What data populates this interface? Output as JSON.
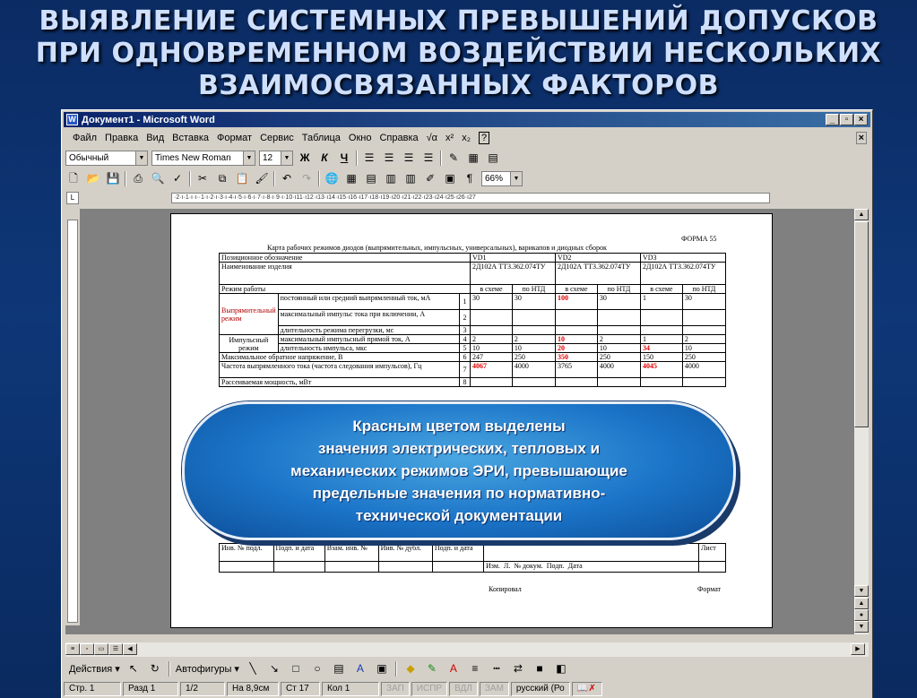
{
  "slide": {
    "title_line1": "ВЫЯВЛЕНИЕ СИСТЕМНЫХ ПРЕВЫШЕНИЙ ДОПУСКОВ",
    "title_line2": "ПРИ ОДНОВРЕМЕННОМ ВОЗДЕЙСТВИИ НЕСКОЛЬКИХ",
    "title_line3": "ВЗАИМОСВЯЗАННЫХ ФАКТОРОВ",
    "callout_line1": "Красным цветом выделены",
    "callout_line2": "значения электрических, тепловых и",
    "callout_line3": "механических режимов ЭРИ, превышающие",
    "callout_line4": "предельные значения по нормативно-",
    "callout_line5": "технической документации"
  },
  "window": {
    "title": "Документ1 - Microsoft Word",
    "minimize": "_",
    "maximize": "▫",
    "close": "×"
  },
  "menu": [
    "Файл",
    "Правка",
    "Вид",
    "Вставка",
    "Формат",
    "Сервис",
    "Таблица",
    "Окно",
    "Справка"
  ],
  "formatting": {
    "style": "Обычный",
    "font": "Times New Roman",
    "size": "12",
    "bold": "Ж",
    "italic": "К",
    "underline": "Ч"
  },
  "standard": {
    "zoom": "66%"
  },
  "ruler_text": "·2·ı·1·ı·ı··1·ı·2·ı·3·ı·4·ı·5·ı·6·ı·7·ı·8·ı·9·ı·10·ı11·ı12·ı13·ı14·ı15·ı16·ı17·ı18·ı19·ı20·ı21·ı22·ı23·ı24·ı25·ı26·ı27",
  "form": {
    "forma": "ФОРМА 55",
    "heading": "Карта рабочих режимов диодов (выпрямительных, импульсных, универсальных), варикапов и диодных сборок",
    "pos_label": "Позиционное обозначение",
    "name_label": "Наименование изделия",
    "mode_label": "Режим работы",
    "vd1": "VD1",
    "vd2": "VD2",
    "vd3": "VD3",
    "name1": "2Д102А ТТ3.362.074ТУ",
    "name2": "2Д102А ТТ3.362.074ТУ",
    "name3": "2Д102А ТТ3.362.074ТУ",
    "in_scheme": "в схеме",
    "by_ntd": "по НТД",
    "rectify_group": "Выпрямительный режим",
    "pulse_group": "Импульсный режим",
    "rows": [
      {
        "label": "постоянный или средний выпрямленный ток, мА",
        "n": "1",
        "v": [
          "30",
          "30",
          "100",
          "30",
          "1",
          "30"
        ]
      },
      {
        "label": "максимальный импульс тока при включении, А",
        "n": "2",
        "v": [
          "",
          "",
          "",
          "",
          "",
          ""
        ]
      },
      {
        "label": "длительность режима перегрузки, мс",
        "n": "3",
        "v": [
          "",
          "",
          "",
          "",
          "",
          ""
        ]
      },
      {
        "label": "максимальный импульсный прямой ток, А",
        "n": "4",
        "v": [
          "2",
          "2",
          "10",
          "2",
          "1",
          "2"
        ]
      },
      {
        "label": "длительность импульса, мкс",
        "n": "5",
        "v": [
          "10",
          "10",
          "20",
          "10",
          "34",
          "10"
        ]
      },
      {
        "label": "Максимальное обратное напряжение, В",
        "n": "6",
        "v": [
          "247",
          "250",
          "350",
          "250",
          "150",
          "250"
        ]
      },
      {
        "label": "Частота выпрямленного тока (частота следования импульсов), Гц",
        "n": "7",
        "v": [
          "4067",
          "4000",
          "3765",
          "4000",
          "4045",
          "4000"
        ]
      },
      {
        "label": "Рассеиваемая мощность, мВт",
        "n": "8",
        "v": [
          "",
          "",
          "",
          "",
          "",
          ""
        ]
      }
    ],
    "footer_cols": [
      "Инв. № подл.",
      "Подп. и дата",
      "Взам. инв. №",
      "Инв. № дубл.",
      "Подп. и дата"
    ],
    "list": "Лист",
    "stamp": [
      "Изм.",
      "Л.",
      "№ докум.",
      "Подп.",
      "Дата"
    ],
    "copied": "Копировал",
    "format": "Формат"
  },
  "drawing": {
    "actions": "Действия ▾",
    "autoshapes": "Автофигуры ▾"
  },
  "status": {
    "page": "Стр. 1",
    "section": "Разд 1",
    "pages": "1/2",
    "at": "На 8,9см",
    "line": "Ст 17",
    "col": "Кол 1",
    "rec": "ЗАП",
    "trk": "ИСПР",
    "ext": "ВДЛ",
    "ovr": "ЗАМ",
    "lang": "русский (Ро"
  },
  "colors": {
    "slide_bg": "#0e3778",
    "title_text": "#cfe0ff",
    "callout_fill": "#1b74c8",
    "exceed_red": "#e00000"
  }
}
